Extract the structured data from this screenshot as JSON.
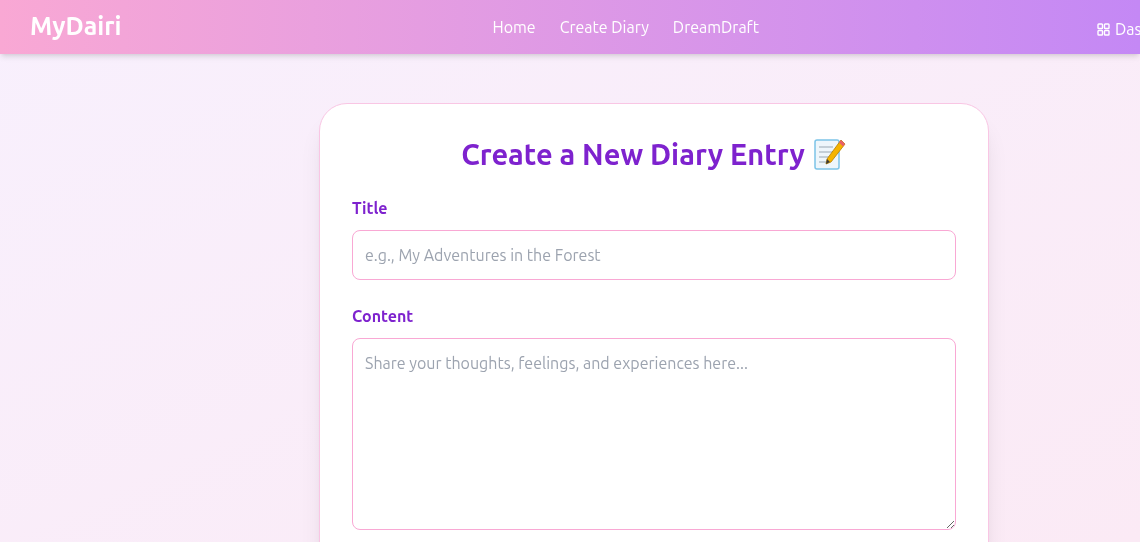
{
  "navbar": {
    "brand": "MyDairi",
    "links": [
      "Home",
      "Create Diary",
      "DreamDraft"
    ],
    "right_link": "Das"
  },
  "form": {
    "heading": "Create a New Diary Entry",
    "fields": [
      {
        "kind": "input",
        "label": "Title",
        "placeholder": "e.g., My Adventures in the Forest"
      },
      {
        "kind": "textarea",
        "label": "Content",
        "placeholder": "Share your thoughts, feelings, and experiences here..."
      }
    ]
  }
}
